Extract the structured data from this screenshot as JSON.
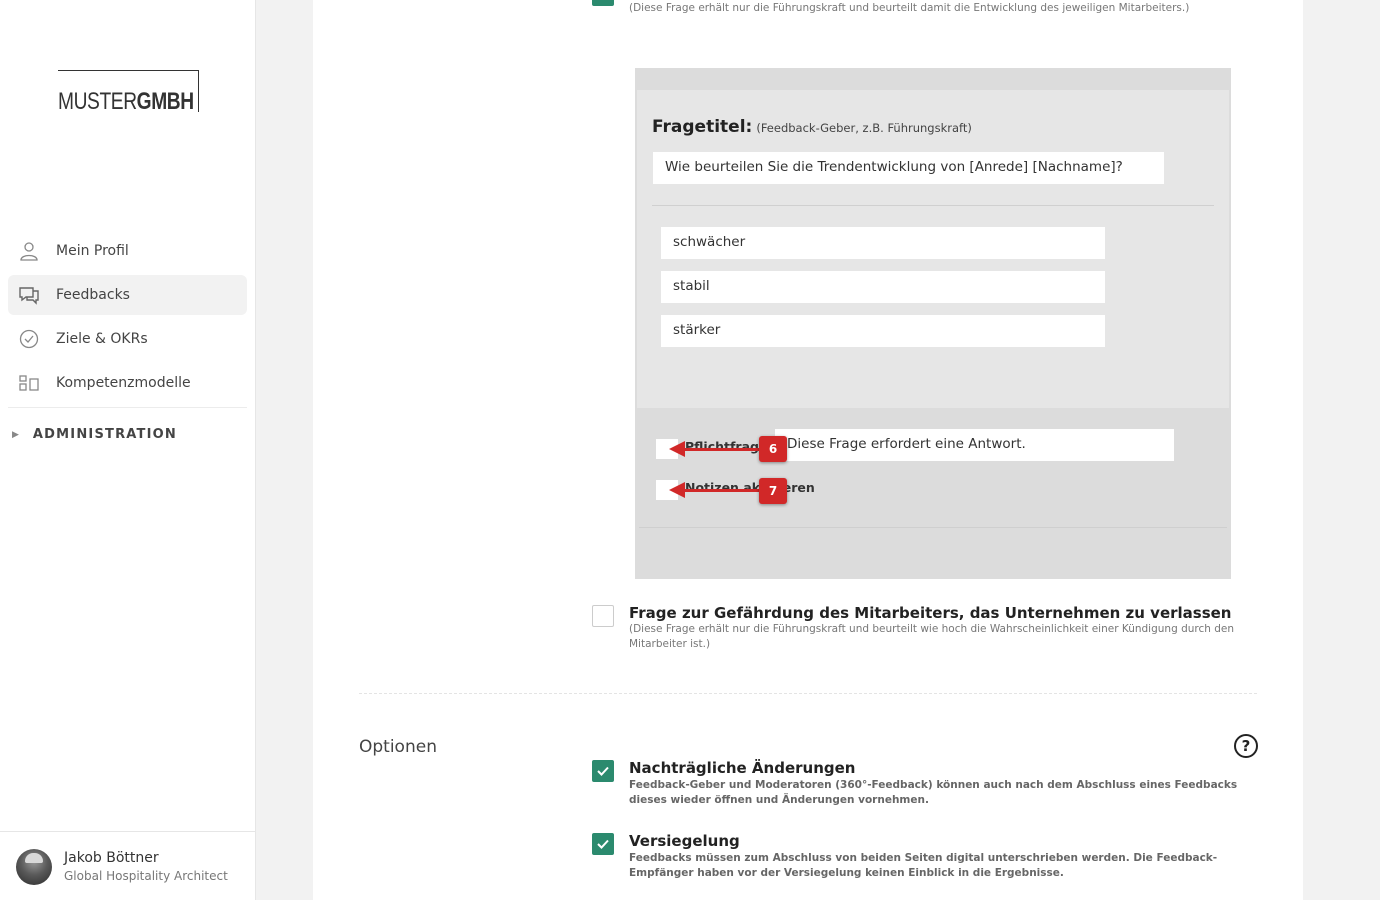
{
  "sidebar": {
    "logo_light": "MUSTER",
    "logo_bold": "GMBH",
    "items": [
      {
        "label": "Mein Profil",
        "icon": "user-icon"
      },
      {
        "label": "Feedbacks",
        "icon": "chat-icon"
      },
      {
        "label": "Ziele & OKRs",
        "icon": "check-circle-icon"
      },
      {
        "label": "Kompetenzmodelle",
        "icon": "model-icon"
      }
    ],
    "admin_label": "ADMINISTRATION",
    "user": {
      "name": "Jakob Böttner",
      "role": "Global Hospitality Architect"
    }
  },
  "main": {
    "top_item_desc": "(Diese Frage erhält nur die Führungskraft und beurteilt damit die Entwicklung des jeweiligen Mitarbeiters.)",
    "preview": {
      "title": "Fragetitel:",
      "title_hint": "(Feedback-Geber, z.B. Führungskraft)",
      "question": "Wie beurteilen Sie die Trendentwicklung von [Anrede] [Nachname]?",
      "answers": [
        "schwächer",
        "stabil",
        "stärker"
      ],
      "required_label": "Pflichtfrage",
      "required_text": "Diese Frage erfordert eine Antwort.",
      "notes_label": "Notizen aktivieren",
      "markers": [
        "6",
        "7"
      ]
    },
    "risk_item": {
      "title": "Frage zur Gefährdung des Mitarbeiters, das Unternehmen zu verlassen",
      "desc": "(Diese Frage erhält nur die Führungskraft und beurteilt wie hoch die Wahrscheinlichkeit einer Kündigung durch den Mitarbeiter ist.)",
      "checked": false
    },
    "options": {
      "label": "Optionen",
      "help": "?",
      "items": [
        {
          "title": "Nachträgliche Änderungen",
          "desc": "Feedback-Geber und Moderatoren (360°-Feedback) können auch nach dem Abschluss eines Feedbacks dieses wieder öffnen und Änderungen vornehmen.",
          "checked": true
        },
        {
          "title": "Versiegelung",
          "desc": "Feedbacks müssen zum Abschluss von beiden Seiten digital unterschrieben werden. Die Feedback-Empfänger haben vor der Versiegelung keinen Einblick in die Ergebnisse.",
          "checked": true
        }
      ]
    }
  },
  "colors": {
    "accent": "#2b8a6e",
    "marker": "#d12828"
  }
}
